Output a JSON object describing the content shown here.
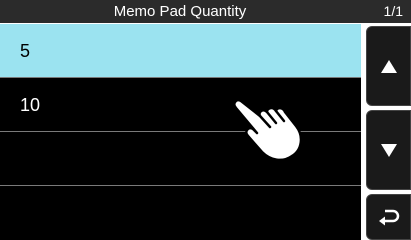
{
  "header": {
    "title": "Memo Pad Quantity",
    "page": "1/1"
  },
  "list": {
    "items": [
      {
        "label": "5",
        "selected": true
      },
      {
        "label": "10",
        "selected": false
      },
      {
        "label": "",
        "selected": false
      },
      {
        "label": "",
        "selected": false
      }
    ]
  },
  "side_buttons": {
    "up_icon": "triangle-up-icon",
    "down_icon": "triangle-down-icon",
    "back_icon": "return-arrow-icon"
  },
  "colors": {
    "titlebar_bg": "#2b2b2b",
    "list_bg": "#000000",
    "selected_row": "#9be3f0",
    "divider": "#7a7a7a"
  },
  "overlay": {
    "icon": "pointing-hand-icon"
  }
}
